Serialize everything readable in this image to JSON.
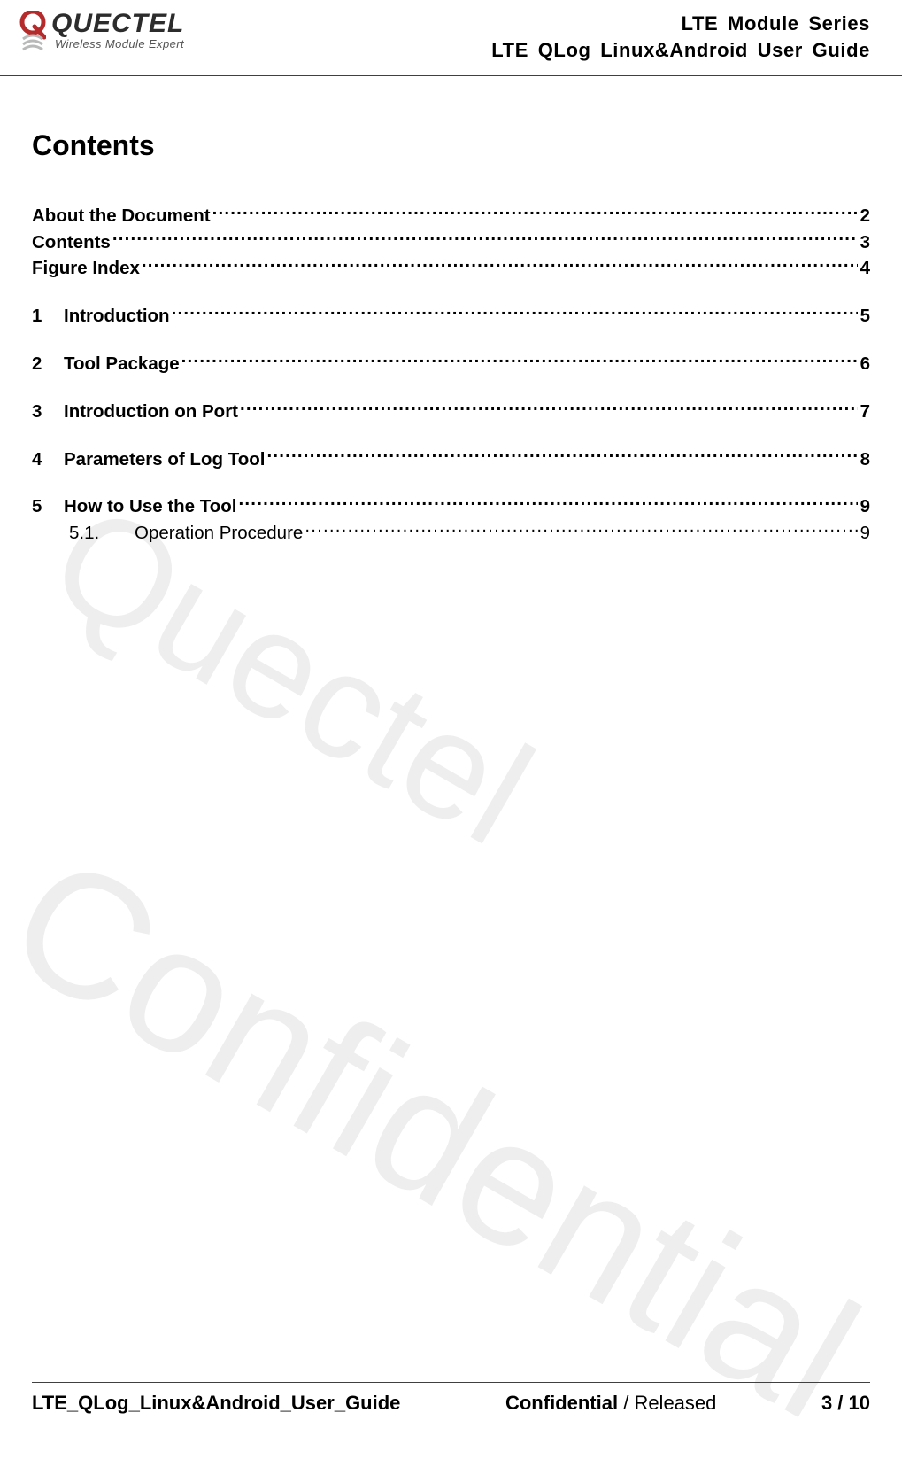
{
  "header": {
    "logo_main": "QUECTEL",
    "logo_sub": "Wireless Module Expert",
    "line1": "LTE Module Series",
    "line2": "LTE QLog Linux&Android User Guide"
  },
  "title": "Contents",
  "toc_front": [
    {
      "label": "About the Document",
      "page": "2"
    },
    {
      "label": "Contents",
      "page": "3"
    },
    {
      "label": "Figure Index",
      "page": "4"
    }
  ],
  "toc_chapters": [
    {
      "num": "1",
      "label": "Introduction",
      "page": "5",
      "subs": []
    },
    {
      "num": "2",
      "label": "Tool Package",
      "page": "6",
      "subs": []
    },
    {
      "num": "3",
      "label": "Introduction on Port",
      "page": "7",
      "subs": []
    },
    {
      "num": "4",
      "label": "Parameters of Log Tool",
      "page": "8",
      "subs": []
    },
    {
      "num": "5",
      "label": "How to Use the Tool",
      "page": "9",
      "subs": [
        {
          "num": "5.1.",
          "label": "Operation Procedure",
          "page": "9"
        }
      ]
    }
  ],
  "watermark": {
    "w1": "Quectel",
    "w2": "Confidential"
  },
  "footer": {
    "left": "LTE_QLog_Linux&Android_User_Guide",
    "center_bold": "Confidential",
    "center_sep": " / ",
    "center_rel": "Released",
    "right": "3 / 10"
  }
}
